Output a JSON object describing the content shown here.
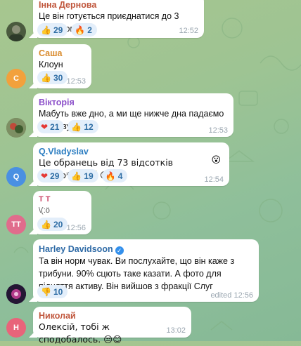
{
  "colors": {
    "bubble": "#ffffff",
    "reaction_bg": "#e3eefa",
    "reaction_text": "#2f6ea5",
    "timestamp": "#9aa6b0",
    "verified": "#3390ec"
  },
  "messages": [
    {
      "author": "Інна Дернова",
      "author_color": "#c0563c",
      "text": "Це він готується приєднатися до 3 штурмової!",
      "reactions": [
        {
          "emoji": "👍",
          "icon": "thumbs-up-icon",
          "count": "29"
        },
        {
          "emoji": "🔥",
          "icon": "fire-icon",
          "count": "2"
        }
      ],
      "time": "12:52"
    },
    {
      "author": "Саша",
      "author_color": "#d98a2b",
      "avatar_letter": "С",
      "avatar_color": "#f2a13c",
      "text": "Клоун",
      "reactions": [
        {
          "emoji": "👍",
          "icon": "thumbs-up-icon",
          "count": "30"
        }
      ],
      "time": "12:53"
    },
    {
      "author": "Вікторія",
      "author_color": "#8b4fc9",
      "text": "Мабуть вже дно, а ми ще нижче дна падаємо у прірву.",
      "reactions": [
        {
          "emoji": "❤",
          "icon": "heart-icon",
          "count": "21"
        },
        {
          "emoji": "👍",
          "icon": "thumbs-up-icon",
          "count": "12"
        }
      ],
      "time": "12:53"
    },
    {
      "author": "Q.Vladyslav",
      "author_color": "#2e7fc2",
      "avatar_letter": "Q",
      "avatar_color": "#4a90e2",
      "text": "Це обранець від 73 відсотків довбо*обів☝️😊",
      "trailing_emoji": "😮",
      "reactions": [
        {
          "emoji": "❤",
          "icon": "heart-icon",
          "count": "29"
        },
        {
          "emoji": "👍",
          "icon": "thumbs-up-icon",
          "count": "19"
        },
        {
          "emoji": "🔥",
          "icon": "fire-icon",
          "count": "4"
        }
      ],
      "time": "12:54"
    },
    {
      "author": "Т Т",
      "author_color": "#cc4a6a",
      "avatar_letter": "ТТ",
      "avatar_color": "#e06c8c",
      "text": "\\(:ö",
      "reactions": [
        {
          "emoji": "👍",
          "icon": "thumbs-up-icon",
          "count": "20"
        }
      ],
      "time": "12:56"
    },
    {
      "author": "Harley Davidsoon",
      "author_color": "#2e6aa6",
      "text": "Та він норм чувак. Ви послухайте, що він каже з трибуни. 90% сцють таке казати. А фото для підняття активу. Він вийшов з фракції Слуг",
      "reactions": [
        {
          "emoji": "👎",
          "icon": "thumbs-down-icon",
          "count": "10"
        }
      ],
      "time": "edited 12:56"
    },
    {
      "author": "Николай",
      "author_color": "#c0563c",
      "avatar_letter": "Н",
      "avatar_color": "#e8647a",
      "text": "Олексій, тобі ж сподобалось. 😒😊",
      "time": "13:02"
    }
  ]
}
